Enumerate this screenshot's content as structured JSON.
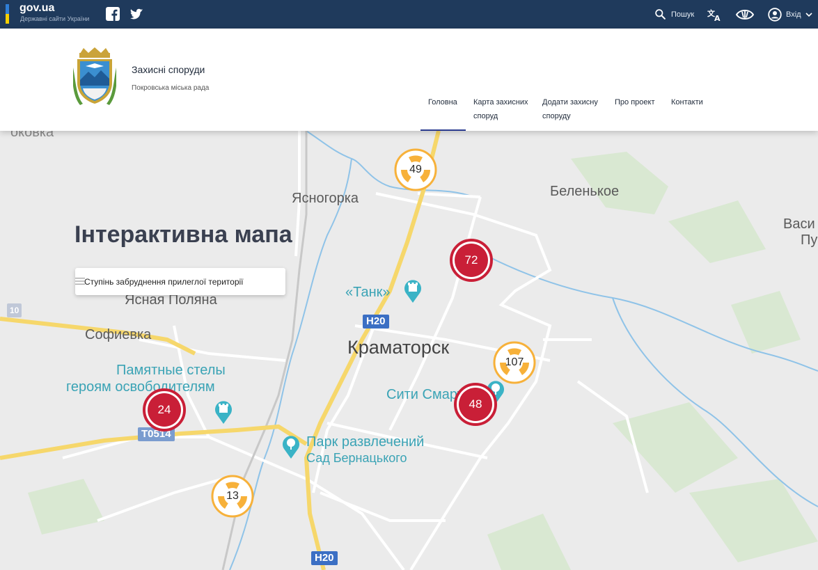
{
  "govbar": {
    "brand": "gov.ua",
    "brand_sub": "Державні сайти України",
    "search_label": "Пошук",
    "login_label": "Вхід"
  },
  "header": {
    "title": "Захисні споруди",
    "subtitle": "Покровська міська рада",
    "nav": [
      {
        "label": "Головна"
      },
      {
        "label": "Карта захисних споруд"
      },
      {
        "label": "Додати захисну споруду"
      },
      {
        "label": "Про проект"
      },
      {
        "label": "Контакти"
      }
    ]
  },
  "map": {
    "heading": "Інтерактивна мапа",
    "filter_label": "Ступінь забруднення прилеглої території",
    "labels": {
      "top_cut": "оковка",
      "yasnogorka": "Ясногорка",
      "belenkoe": "Беленькое",
      "vasi": "Васи",
      "pu": "Пу",
      "yasnaya": "Ясная Поляна",
      "sofievka": "Софиевка",
      "stely1": "Памятные стелы",
      "stely2": "героям освободителям",
      "tank": "«Танк»",
      "kramatorsk": "Краматорск",
      "sity": "Сити Смарт",
      "park1": "Парк развлечений",
      "park2": "Сад Бернацького",
      "left_cut": "10"
    },
    "roads": {
      "h20_top": "H20",
      "h20_bottom": "H20",
      "t0514": "T0514"
    },
    "clusters": [
      {
        "count": "49",
        "kind": "orange"
      },
      {
        "count": "72",
        "kind": "red"
      },
      {
        "count": "107",
        "kind": "orange"
      },
      {
        "count": "48",
        "kind": "red"
      },
      {
        "count": "24",
        "kind": "red"
      },
      {
        "count": "13",
        "kind": "orange"
      }
    ],
    "colors": {
      "red": "#c91f37",
      "orange": "#f7b13a",
      "road_yellow": "#f6d76b",
      "water": "#8fc3e8",
      "poi": "#3aa3b5"
    }
  }
}
